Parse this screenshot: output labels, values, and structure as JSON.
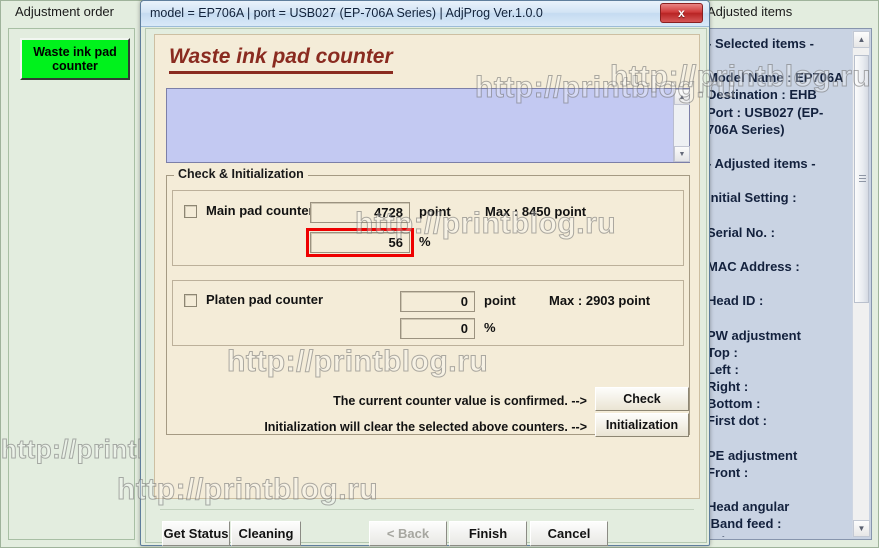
{
  "background_window": {
    "left_caption": "Adjustment order",
    "right_caption": "Adjusted items",
    "waste_button_label": "Waste ink pad counter",
    "adjusted_items_text": "- Selected items -\n\nModel Name : EP706A\nDestination : EHB\nPort : USB027 (EP-706A Series)\n\n- Adjusted items -\n\nInitial Setting :\n\nSerial No. :\n\nMAC Address :\n\nHead ID :\n\nPW adjustment\nTop :\nLeft :\nRight :\nBottom :\nFirst dot :\n\nPE adjustment\nFront :\n\nHead angular\n Band feed :\n Microwave :",
    "scroll_up_icon": "scroll-up-arrow",
    "scroll_down_icon": "scroll-down-arrow"
  },
  "dialog": {
    "title": "model = EP706A | port = USB027 (EP-706A Series) | AdjProg Ver.1.0.0",
    "close_label": "x",
    "heading": "Waste ink pad counter",
    "log_text": "",
    "groupbox_legend": "Check & Initialization",
    "counters": [
      {
        "id": "main-pad-counter",
        "label": "Main pad counter",
        "checked": false,
        "point_value": "4728",
        "point_unit": "point",
        "max_label": "Max : 8450 point",
        "percent_value": "56",
        "percent_unit": "%",
        "highlighted": true
      },
      {
        "id": "platen-pad-counter",
        "label": "Platen pad counter",
        "checked": false,
        "point_value": "0",
        "point_unit": "point",
        "max_label": "Max : 2903 point",
        "percent_value": "0",
        "percent_unit": "%",
        "highlighted": false
      }
    ],
    "check_line": "The current counter value is confirmed. -->",
    "check_button": "Check",
    "init_line": "Initialization will clear the selected above counters. -->",
    "init_button": "Initialization",
    "buttons": {
      "get_status": "Get Status",
      "cleaning": "Cleaning",
      "back": "< Back",
      "finish": "Finish",
      "cancel": "Cancel"
    }
  },
  "watermark": {
    "text": "http://printblog.ru"
  },
  "colors": {
    "accent_heading": "#8a2b20",
    "highlight_box": "#ee0000",
    "waste_button": "#00f21c",
    "dialog_body": "#e3eddf",
    "cream_card": "#f4ecd8",
    "log_box": "#c3c9f2",
    "right_panel": "#c9d3e3"
  }
}
